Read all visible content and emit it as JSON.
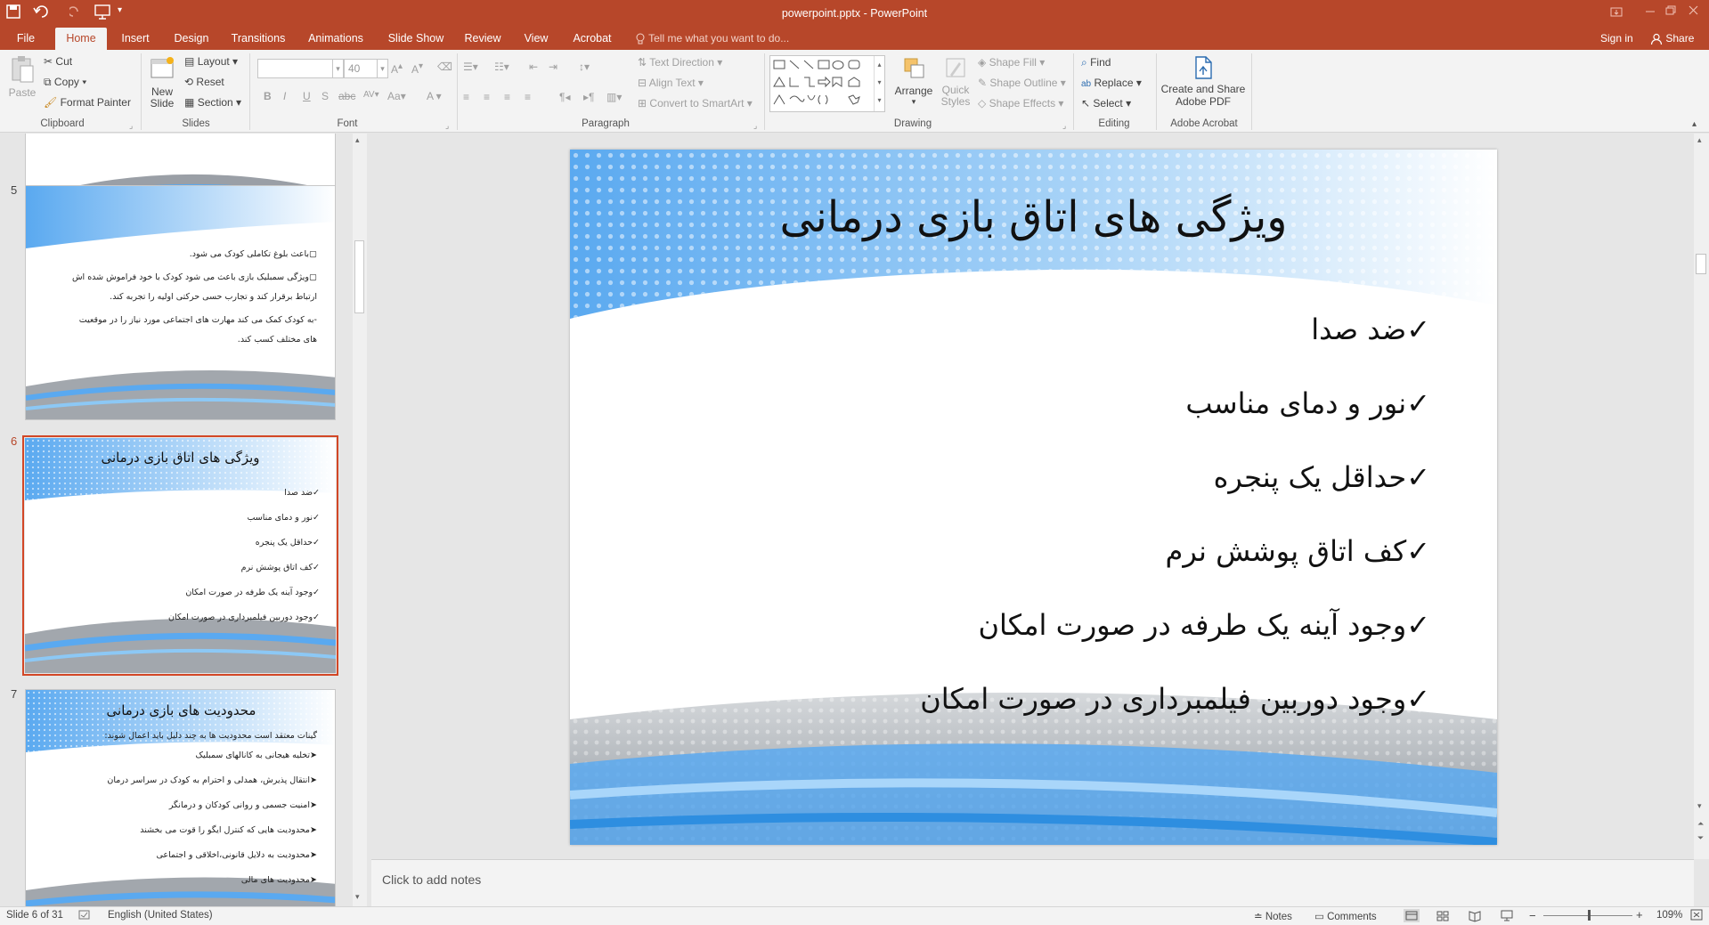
{
  "window": {
    "title": "powerpoint.pptx - PowerPoint"
  },
  "tabs": [
    "File",
    "Home",
    "Insert",
    "Design",
    "Transitions",
    "Animations",
    "Slide Show",
    "Review",
    "View",
    "Acrobat"
  ],
  "tell_me": "Tell me what you want to do...",
  "account": {
    "sign_in": "Sign in",
    "share": "Share"
  },
  "ribbon": {
    "clipboard": {
      "label": "Clipboard",
      "paste": "Paste",
      "cut": "Cut",
      "copy": "Copy",
      "format_painter": "Format Painter"
    },
    "slides": {
      "label": "Slides",
      "new_slide_1": "New",
      "new_slide_2": "Slide",
      "layout": "Layout",
      "reset": "Reset",
      "section": "Section"
    },
    "font": {
      "label": "Font",
      "font_name": "",
      "font_size": "40",
      "bold": "B",
      "italic": "I",
      "underline": "U",
      "strike": "S",
      "spacing": "AV",
      "case": "Aa",
      "color": "A"
    },
    "paragraph": {
      "label": "Paragraph",
      "text_direction": "Text Direction",
      "align_text": "Align Text",
      "convert_smartart": "Convert to SmartArt"
    },
    "drawing": {
      "label": "Drawing",
      "arrange": "Arrange",
      "quick_styles_1": "Quick",
      "quick_styles_2": "Styles",
      "shape_fill": "Shape Fill",
      "shape_outline": "Shape Outline",
      "shape_effects": "Shape Effects"
    },
    "editing": {
      "label": "Editing",
      "find": "Find",
      "replace": "Replace",
      "select": "Select"
    },
    "acrobat": {
      "label": "Adobe Acrobat",
      "create_1": "Create and Share",
      "create_2": "Adobe PDF"
    }
  },
  "thumbnails": [
    {
      "num": "5",
      "lines": [
        "باعث بلوغ تکاملی کودک می شود.",
        "ویژگی سمبلیک بازی باعث می شود کودک با خود فراموش شده اش",
        "ارتباط برقرار کند و تجارب حسی حرکتی اولیه را تجربه کند.",
        "-به کودک کمک می کند مهارت های اجتماعی مورد نیاز را در موقعیت",
        "های مختلف کسب کند."
      ]
    },
    {
      "num": "6",
      "title": "ویژگی های اتاق بازی درمانی",
      "lines": [
        "ضد صدا",
        "نور و دمای مناسب",
        "حداقل یک پنجره",
        "کف اتاق پوشش نرم",
        "وجود آینه یک طرفه در صورت امکان",
        "وجود دوربین فیلمبرداری در صورت امکان"
      ]
    },
    {
      "num": "7",
      "title": "محدودیت های بازی درمانی",
      "intro": "گینات معتقد است محدودیت ها به چند دلیل باید اعمال شوند:",
      "lines": [
        "تخلیه هیجانی به کانالهای سمبلیک",
        "انتقال پذیرش، همدلی و احترام به کودک در سراسر درمان",
        "امنیت جسمی و روانی کودکان و درمانگر",
        "محدودیت هایی که کنترل ایگو را قوت می بخشند",
        "محدودیت به دلایل قانونی،اخلاقی و اجتماعی",
        "محدودیت های مالی"
      ]
    }
  ],
  "slide": {
    "title": "ویژگی های اتاق بازی درمانی",
    "check": "✓",
    "bullets": [
      "ضد صدا",
      "نور و دمای مناسب",
      "حداقل یک پنجره",
      "کف اتاق پوشش نرم",
      "وجود آینه یک طرفه در صورت امکان",
      "وجود دوربین فیلمبرداری در صورت امکان"
    ]
  },
  "notes_placeholder": "Click to add notes",
  "status": {
    "slide_info": "Slide 6 of 31",
    "language": "English (United States)",
    "notes": "Notes",
    "comments": "Comments",
    "zoom": "109%"
  },
  "colors": {
    "accent": "#b7472a",
    "slide_blue": "#5aa9f0"
  }
}
